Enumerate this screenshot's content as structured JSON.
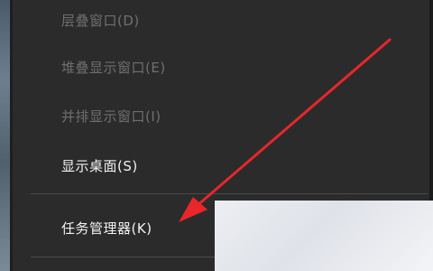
{
  "context_menu": {
    "items": [
      {
        "label": "层叠窗口(D)",
        "enabled": false
      },
      {
        "label": "堆叠显示窗口(E)",
        "enabled": false
      },
      {
        "label": "并排显示窗口(I)",
        "enabled": false
      },
      {
        "label": "显示桌面(S)",
        "enabled": true
      },
      {
        "label": "任务管理器(K)",
        "enabled": true
      }
    ]
  },
  "colors": {
    "menu_background": "#2b2b2b",
    "disabled_text": "#6f6f6f",
    "enabled_text": "#f2f2f2",
    "annotation_arrow": "#e8262b"
  },
  "annotation": {
    "type": "arrow",
    "points_to": "任务管理器(K)"
  }
}
